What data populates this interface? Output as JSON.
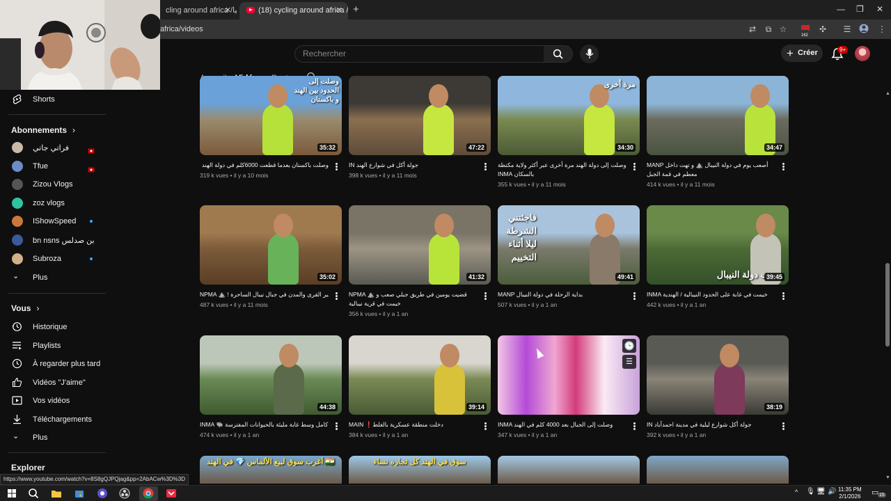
{
  "browser": {
    "tabs": [
      {
        "label": "cling around africa /يفريقيا",
        "active": false
      },
      {
        "label": "(18) cycling around africa /يفريقيا",
        "active": true
      }
    ],
    "new_tab": "+",
    "url": "africa/videos",
    "extension_badge": "162",
    "status_url": "https://www.youtube.com/watch?v=8S8gQJPQjag&pp=2AbACw%3D%3D"
  },
  "header": {
    "search_placeholder": "Rechercher",
    "create_label": "Créer",
    "notifications_badge": "9+"
  },
  "channel_tabs": [
    "Accueil",
    "Vidéos",
    "Posts"
  ],
  "sidebar": {
    "shorts": "Shorts",
    "subscriptions_title": "Abonnements",
    "subscriptions": [
      {
        "name": "فراتي جاتي",
        "indicator": "live",
        "color": "#c9b9a9"
      },
      {
        "name": "Tfue",
        "indicator": "live",
        "color": "#6b8cc7"
      },
      {
        "name": "Zizou Vlogs",
        "indicator": "",
        "color": "#555555"
      },
      {
        "name": "zoz vlogs",
        "indicator": "",
        "color": "#2ec4a0"
      },
      {
        "name": "IShowSpeed",
        "indicator": "dot",
        "color": "#c8783c"
      },
      {
        "name": "bn nsns بن صدلس",
        "indicator": "",
        "color": "#3a5a9a"
      },
      {
        "name": "Subroza",
        "indicator": "dot",
        "color": "#d4b08a"
      }
    ],
    "subs_more": "Plus",
    "you_title": "Vous",
    "you_items": [
      "Historique",
      "Playlists",
      "À regarder plus tard",
      "Vidéos \"J'aime\"",
      "Vos vidéos",
      "Téléchargements"
    ],
    "you_more": "Plus",
    "explore_title": "Explorer"
  },
  "videos": [
    {
      "title": "وصلت باكستان بعدما قطعت 6000كلم في دولة الهند 🚲",
      "views": "319 k vues",
      "age": "il y a 10 mois",
      "duration": "35:32",
      "overlay": "وصلت إلى الحدود بين الهند و باكستان",
      "wrap": false
    },
    {
      "title": "جولة أكل في شوارع الهند IN",
      "views": "398 k vues",
      "age": "il y a 11 mois",
      "duration": "47:22",
      "overlay": "",
      "wrap": false
    },
    {
      "title": "وصلت إلى دولة الهند مرة أخرى عبر أكثر ولاية مكتظة بالسكان INMA",
      "views": "355 k vues",
      "age": "il y a 11 mois",
      "duration": "34:30",
      "overlay": "مرة أخرى",
      "wrap": true
    },
    {
      "title": "MANP أصعب يوم في دولة النيبال ⛰️ و تهت داخل معطم في قمة الجبل",
      "views": "414 k vues",
      "age": "il y a 11 mois",
      "duration": "34:47",
      "overlay": "",
      "wrap": true
    },
    {
      "title": "NPMA ⛰️ ! رحلة عبر القرى والمدن في جبال نيبال الساحرة",
      "views": "487 k vues",
      "age": "il y a 11 mois",
      "duration": "35:02",
      "overlay": "",
      "wrap": false
    },
    {
      "title": "NPMA ⛰️ قضيت يومين في طريق جبلي صعب و خيمت في قرية نيبالية",
      "views": "356 k vues",
      "age": "il y a 1 an",
      "duration": "41:32",
      "overlay": "",
      "wrap": true
    },
    {
      "title": "MANP بداية الرحلة في دولة النيبال",
      "views": "507 k vues",
      "age": "il y a 1 an",
      "duration": "49:41",
      "overlay": "فاجئتني الشرطة ليلا أثناء التخييم",
      "wrap": false
    },
    {
      "title": "INMA خيمت في غابة على الحدود النيبالية / الهندية",
      "views": "442 k vues",
      "age": "il y a 1 an",
      "duration": "39:45",
      "overlay": "ت دولة النيبال",
      "wrap": false
    },
    {
      "title": "INMA 🐃 يوم كامل وسط غابة مليئة بالحيوانات المفترسة",
      "views": "474 k vues",
      "age": "il y a 1 an",
      "duration": "44:38",
      "overlay": "",
      "wrap": false
    },
    {
      "title": "MAIN ❗دخلت منطقة عسكرية بالغلط",
      "views": "384 k vues",
      "age": "il y a 1 an",
      "duration": "39:14",
      "overlay": "",
      "wrap": false
    },
    {
      "title": "INMA وصلت إلى الجبال بعد 4000 كلم في الهند",
      "views": "347 k vues",
      "age": "il y a 1 an",
      "duration": "",
      "overlay": "",
      "wrap": false
    },
    {
      "title": "IN جولة أكل شوارع ليلية في مدينة احمدآباد",
      "views": "392 k vues",
      "age": "il y a 1 an",
      "duration": "38:19",
      "overlay": "",
      "wrap": false
    }
  ],
  "bottom_overlays": [
    "🇮🇳 أغرب سوق لبيع الألماس 💎 في الهند",
    "سوق في الهند كل تجاره نساء",
    "",
    ""
  ],
  "taskbar": {
    "time": "11:35 PM",
    "date": "2/1/2026",
    "notif_count": "15"
  }
}
